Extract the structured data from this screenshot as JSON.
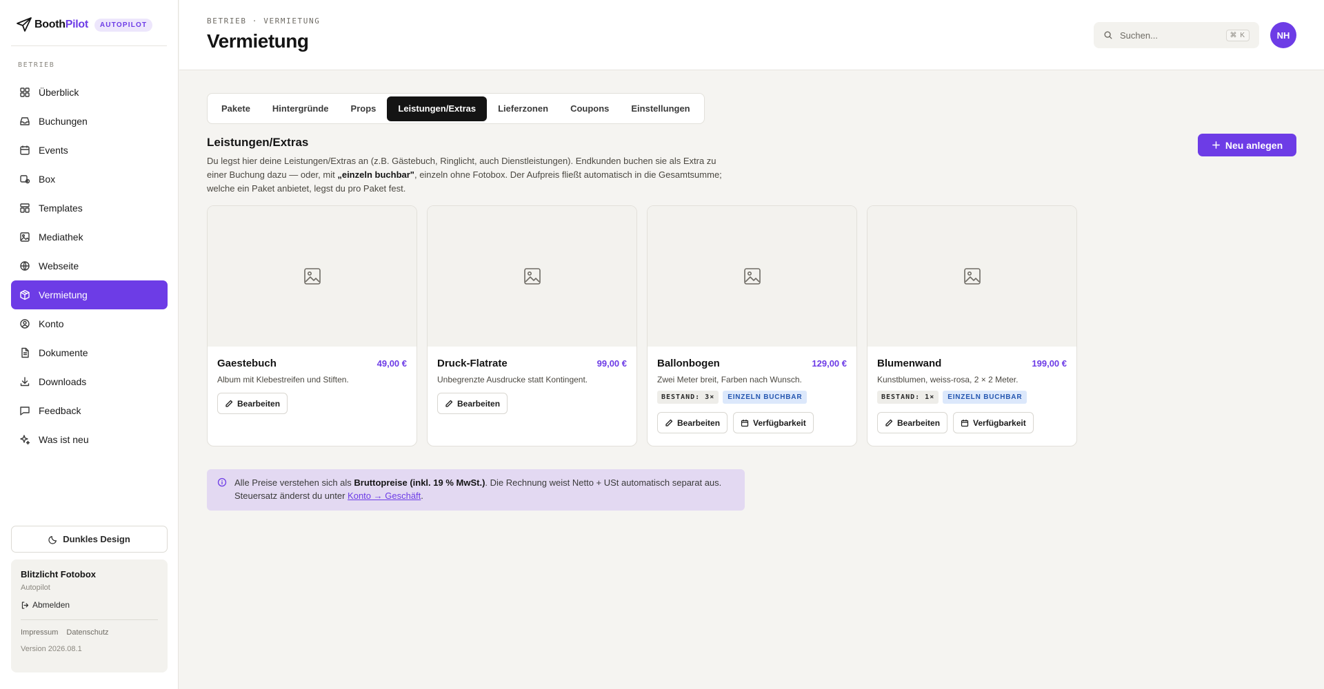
{
  "brand": {
    "name_part1": "Booth",
    "name_part2": "Pilot",
    "badge": "AUTOPILOT"
  },
  "sidebar": {
    "section_label": "BETRIEB",
    "items": [
      {
        "label": "Überblick",
        "icon": "grid-icon"
      },
      {
        "label": "Buchungen",
        "icon": "inbox-icon"
      },
      {
        "label": "Events",
        "icon": "calendar-icon"
      },
      {
        "label": "Box",
        "icon": "box-icon"
      },
      {
        "label": "Templates",
        "icon": "template-icon"
      },
      {
        "label": "Mediathek",
        "icon": "image-icon"
      },
      {
        "label": "Webseite",
        "icon": "globe-icon"
      },
      {
        "label": "Vermietung",
        "icon": "package-icon",
        "active": true
      },
      {
        "label": "Konto",
        "icon": "user-circle-icon"
      },
      {
        "label": "Dokumente",
        "icon": "document-icon"
      },
      {
        "label": "Downloads",
        "icon": "download-icon"
      },
      {
        "label": "Feedback",
        "icon": "message-icon"
      },
      {
        "label": "Was ist neu",
        "icon": "sparkle-icon"
      }
    ],
    "theme_button": "Dunkles Design",
    "account": {
      "name": "Blitzlicht Fotobox",
      "plan": "Autopilot",
      "logout": "Abmelden",
      "legal": [
        "Impressum",
        "Datenschutz"
      ],
      "version": "Version 2026.08.1"
    }
  },
  "header": {
    "breadcrumb": "BETRIEB · VERMIETUNG",
    "title": "Vermietung",
    "search_placeholder": "Suchen...",
    "shortcut": "⌘ K",
    "avatar_initials": "NH"
  },
  "tabs": [
    {
      "label": "Pakete"
    },
    {
      "label": "Hintergründe"
    },
    {
      "label": "Props"
    },
    {
      "label": "Leistungen/Extras",
      "active": true
    },
    {
      "label": "Lieferzonen"
    },
    {
      "label": "Coupons"
    },
    {
      "label": "Einstellungen"
    }
  ],
  "section": {
    "title": "Leistungen/Extras",
    "desc_part1": "Du legst hier deine Leistungen/Extras an (z.B. Gästebuch, Ringlicht, auch Dienstleistungen). Endkunden buchen sie als Extra zu einer Buchung dazu — oder, mit ",
    "desc_bold": "„einzeln buchbar\"",
    "desc_part2": ", einzeln ohne Fotobox. Der Aufpreis fließt automatisch in die Gesamtsumme; welche ein Paket anbietet, legst du pro Paket fest.",
    "new_button": "Neu anlegen"
  },
  "cards": [
    {
      "name": "Gaestebuch",
      "price": "49,00 €",
      "desc": "Album mit Klebestreifen und Stiften.",
      "edit": "Bearbeiten"
    },
    {
      "name": "Druck-Flatrate",
      "price": "99,00 €",
      "desc": "Unbegrenzte Ausdrucke statt Kontingent.",
      "edit": "Bearbeiten"
    },
    {
      "name": "Ballonbogen",
      "price": "129,00 €",
      "desc": "Zwei Meter breit, Farben nach Wunsch.",
      "stock": "BESTAND: 3×",
      "single": "EINZELN BUCHBAR",
      "edit": "Bearbeiten",
      "availability": "Verfügbarkeit"
    },
    {
      "name": "Blumenwand",
      "price": "199,00 €",
      "desc": "Kunstblumen, weiss-rosa, 2 × 2 Meter.",
      "stock": "BESTAND: 1×",
      "single": "EINZELN BUCHBAR",
      "edit": "Bearbeiten",
      "availability": "Verfügbarkeit"
    }
  ],
  "info": {
    "part1": "Alle Preise verstehen sich als ",
    "bold": "Bruttopreise (inkl. 19 % MwSt.)",
    "part2": ". Die Rechnung weist Netto + USt automatisch separat aus. Steuersatz änderst du unter ",
    "link": "Konto → Geschäft",
    "part3": "."
  },
  "colors": {
    "accent": "#6d3ce6",
    "tab_active": "#141414",
    "info_bg": "#e3d9f2",
    "badge_single": "#dce8fb"
  }
}
